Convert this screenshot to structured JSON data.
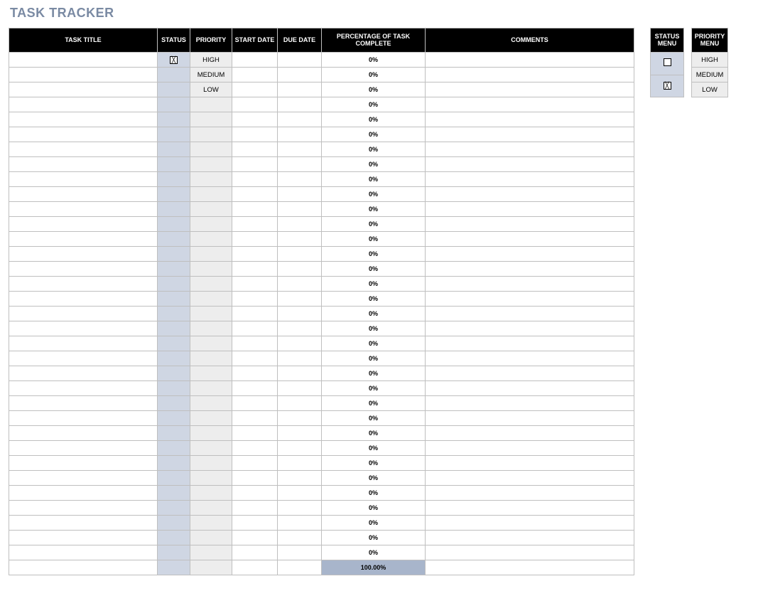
{
  "title": "TASK TRACKER",
  "columns": {
    "task_title": "TASK TITLE",
    "status": "STATUS",
    "priority": "PRIORITY",
    "start_date": "START DATE",
    "due_date": "DUE DATE",
    "pct": "PERCENTAGE OF TASK COMPLETE",
    "comments": "COMMENTS"
  },
  "rows": [
    {
      "task_title": "",
      "status_checked": true,
      "priority": "HIGH",
      "start_date": "",
      "due_date": "",
      "pct": "0%",
      "comments": ""
    },
    {
      "task_title": "",
      "status_checked": false,
      "priority": "MEDIUM",
      "start_date": "",
      "due_date": "",
      "pct": "0%",
      "comments": ""
    },
    {
      "task_title": "",
      "status_checked": false,
      "priority": "LOW",
      "start_date": "",
      "due_date": "",
      "pct": "0%",
      "comments": ""
    },
    {
      "task_title": "",
      "status_checked": false,
      "priority": "",
      "start_date": "",
      "due_date": "",
      "pct": "0%",
      "comments": ""
    },
    {
      "task_title": "",
      "status_checked": false,
      "priority": "",
      "start_date": "",
      "due_date": "",
      "pct": "0%",
      "comments": ""
    },
    {
      "task_title": "",
      "status_checked": false,
      "priority": "",
      "start_date": "",
      "due_date": "",
      "pct": "0%",
      "comments": ""
    },
    {
      "task_title": "",
      "status_checked": false,
      "priority": "",
      "start_date": "",
      "due_date": "",
      "pct": "0%",
      "comments": ""
    },
    {
      "task_title": "",
      "status_checked": false,
      "priority": "",
      "start_date": "",
      "due_date": "",
      "pct": "0%",
      "comments": ""
    },
    {
      "task_title": "",
      "status_checked": false,
      "priority": "",
      "start_date": "",
      "due_date": "",
      "pct": "0%",
      "comments": ""
    },
    {
      "task_title": "",
      "status_checked": false,
      "priority": "",
      "start_date": "",
      "due_date": "",
      "pct": "0%",
      "comments": ""
    },
    {
      "task_title": "",
      "status_checked": false,
      "priority": "",
      "start_date": "",
      "due_date": "",
      "pct": "0%",
      "comments": ""
    },
    {
      "task_title": "",
      "status_checked": false,
      "priority": "",
      "start_date": "",
      "due_date": "",
      "pct": "0%",
      "comments": ""
    },
    {
      "task_title": "",
      "status_checked": false,
      "priority": "",
      "start_date": "",
      "due_date": "",
      "pct": "0%",
      "comments": ""
    },
    {
      "task_title": "",
      "status_checked": false,
      "priority": "",
      "start_date": "",
      "due_date": "",
      "pct": "0%",
      "comments": ""
    },
    {
      "task_title": "",
      "status_checked": false,
      "priority": "",
      "start_date": "",
      "due_date": "",
      "pct": "0%",
      "comments": ""
    },
    {
      "task_title": "",
      "status_checked": false,
      "priority": "",
      "start_date": "",
      "due_date": "",
      "pct": "0%",
      "comments": ""
    },
    {
      "task_title": "",
      "status_checked": false,
      "priority": "",
      "start_date": "",
      "due_date": "",
      "pct": "0%",
      "comments": ""
    },
    {
      "task_title": "",
      "status_checked": false,
      "priority": "",
      "start_date": "",
      "due_date": "",
      "pct": "0%",
      "comments": ""
    },
    {
      "task_title": "",
      "status_checked": false,
      "priority": "",
      "start_date": "",
      "due_date": "",
      "pct": "0%",
      "comments": ""
    },
    {
      "task_title": "",
      "status_checked": false,
      "priority": "",
      "start_date": "",
      "due_date": "",
      "pct": "0%",
      "comments": ""
    },
    {
      "task_title": "",
      "status_checked": false,
      "priority": "",
      "start_date": "",
      "due_date": "",
      "pct": "0%",
      "comments": ""
    },
    {
      "task_title": "",
      "status_checked": false,
      "priority": "",
      "start_date": "",
      "due_date": "",
      "pct": "0%",
      "comments": ""
    },
    {
      "task_title": "",
      "status_checked": false,
      "priority": "",
      "start_date": "",
      "due_date": "",
      "pct": "0%",
      "comments": ""
    },
    {
      "task_title": "",
      "status_checked": false,
      "priority": "",
      "start_date": "",
      "due_date": "",
      "pct": "0%",
      "comments": ""
    },
    {
      "task_title": "",
      "status_checked": false,
      "priority": "",
      "start_date": "",
      "due_date": "",
      "pct": "0%",
      "comments": ""
    },
    {
      "task_title": "",
      "status_checked": false,
      "priority": "",
      "start_date": "",
      "due_date": "",
      "pct": "0%",
      "comments": ""
    },
    {
      "task_title": "",
      "status_checked": false,
      "priority": "",
      "start_date": "",
      "due_date": "",
      "pct": "0%",
      "comments": ""
    },
    {
      "task_title": "",
      "status_checked": false,
      "priority": "",
      "start_date": "",
      "due_date": "",
      "pct": "0%",
      "comments": ""
    },
    {
      "task_title": "",
      "status_checked": false,
      "priority": "",
      "start_date": "",
      "due_date": "",
      "pct": "0%",
      "comments": ""
    },
    {
      "task_title": "",
      "status_checked": false,
      "priority": "",
      "start_date": "",
      "due_date": "",
      "pct": "0%",
      "comments": ""
    },
    {
      "task_title": "",
      "status_checked": false,
      "priority": "",
      "start_date": "",
      "due_date": "",
      "pct": "0%",
      "comments": ""
    },
    {
      "task_title": "",
      "status_checked": false,
      "priority": "",
      "start_date": "",
      "due_date": "",
      "pct": "0%",
      "comments": ""
    },
    {
      "task_title": "",
      "status_checked": false,
      "priority": "",
      "start_date": "",
      "due_date": "",
      "pct": "0%",
      "comments": ""
    },
    {
      "task_title": "",
      "status_checked": false,
      "priority": "",
      "start_date": "",
      "due_date": "",
      "pct": "0%",
      "comments": ""
    }
  ],
  "total_pct": "100.00%",
  "status_menu": {
    "header": "STATUS MENU",
    "options": [
      {
        "checked": false
      },
      {
        "checked": true
      }
    ]
  },
  "priority_menu": {
    "header": "PRIORITY MENU",
    "options": [
      "HIGH",
      "MEDIUM",
      "LOW"
    ]
  }
}
